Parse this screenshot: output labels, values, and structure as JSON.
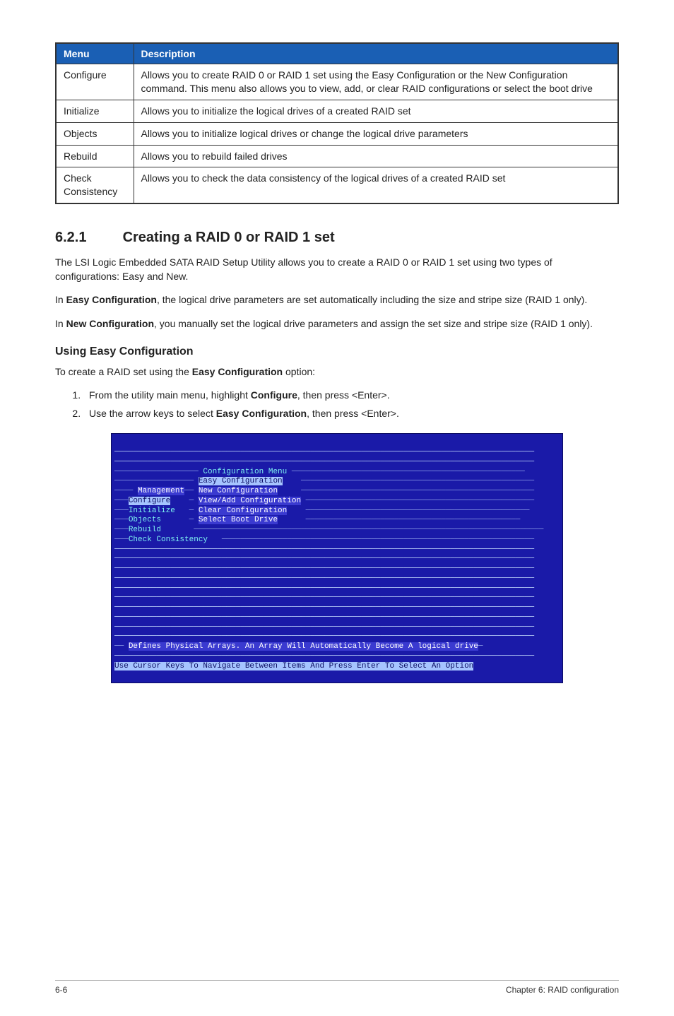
{
  "table": {
    "headers": [
      "Menu",
      "Description"
    ],
    "rows": [
      {
        "menu": "Configure",
        "desc": "Allows you to create RAID 0 or RAID 1 set using the Easy Configuration or the New Configuration command. This menu also allows you to view, add, or clear RAID configurations or select the boot drive"
      },
      {
        "menu": "Initialize",
        "desc": "Allows you to initialize the logical drives of a created RAID set"
      },
      {
        "menu": "Objects",
        "desc": "Allows you to initialize logical drives or change the logical drive parameters"
      },
      {
        "menu": "Rebuild",
        "desc": "Allows you to rebuild failed drives"
      },
      {
        "menu": "Check Consistency",
        "desc": "Allows you to check the data consistency of the logical drives of a created RAID set"
      }
    ]
  },
  "section": {
    "number": "6.2.1",
    "title": "Creating a RAID 0 or RAID 1 set",
    "para1": "The LSI Logic Embedded SATA RAID Setup Utility allows you to create a RAID 0 or RAID 1 set using two types of configurations: Easy and New.",
    "para2a": "In ",
    "para2b": "Easy Configuration",
    "para2c": ", the logical drive parameters are set automatically including the size and stripe size (RAID 1 only).",
    "para3a": "In ",
    "para3b": "New Configuration",
    "para3c": ", you manually set the logical drive parameters and assign the set size and stripe size (RAID 1 only).",
    "sub_heading": "Using Easy Configuration",
    "sub_intro_a": "To create a RAID set using the ",
    "sub_intro_b": "Easy Configuration",
    "sub_intro_c": " option:",
    "step1a": "From the utility main menu, highlight ",
    "step1b": "Configure",
    "step1c": ", then press <Enter>.",
    "step2a": "Use the arrow keys to select ",
    "step2b": "Easy Configuration",
    "step2c": ", then press <Enter>."
  },
  "terminal": {
    "conf_menu_title": "Configuration Menu",
    "easy_conf": "Easy Configuration",
    "mgmt": "Management",
    "new_conf": "New Configuration",
    "configure": "Configure",
    "view_add": "View/Add Configuration",
    "initialize": "Initialize",
    "clear_conf": "Clear Configuration",
    "objects": "Objects",
    "select_boot": "Select Boot Drive",
    "rebuild": "Rebuild",
    "check_cons": "Check Consistency",
    "help": "Defines Physical Arrays. An Array Will Automatically Become A logical drive",
    "hint": "Use Cursor Keys To Navigate Between Items And Press Enter To Select An Option"
  },
  "footer": {
    "left": "6-6",
    "right": "Chapter 6: RAID configuration"
  }
}
